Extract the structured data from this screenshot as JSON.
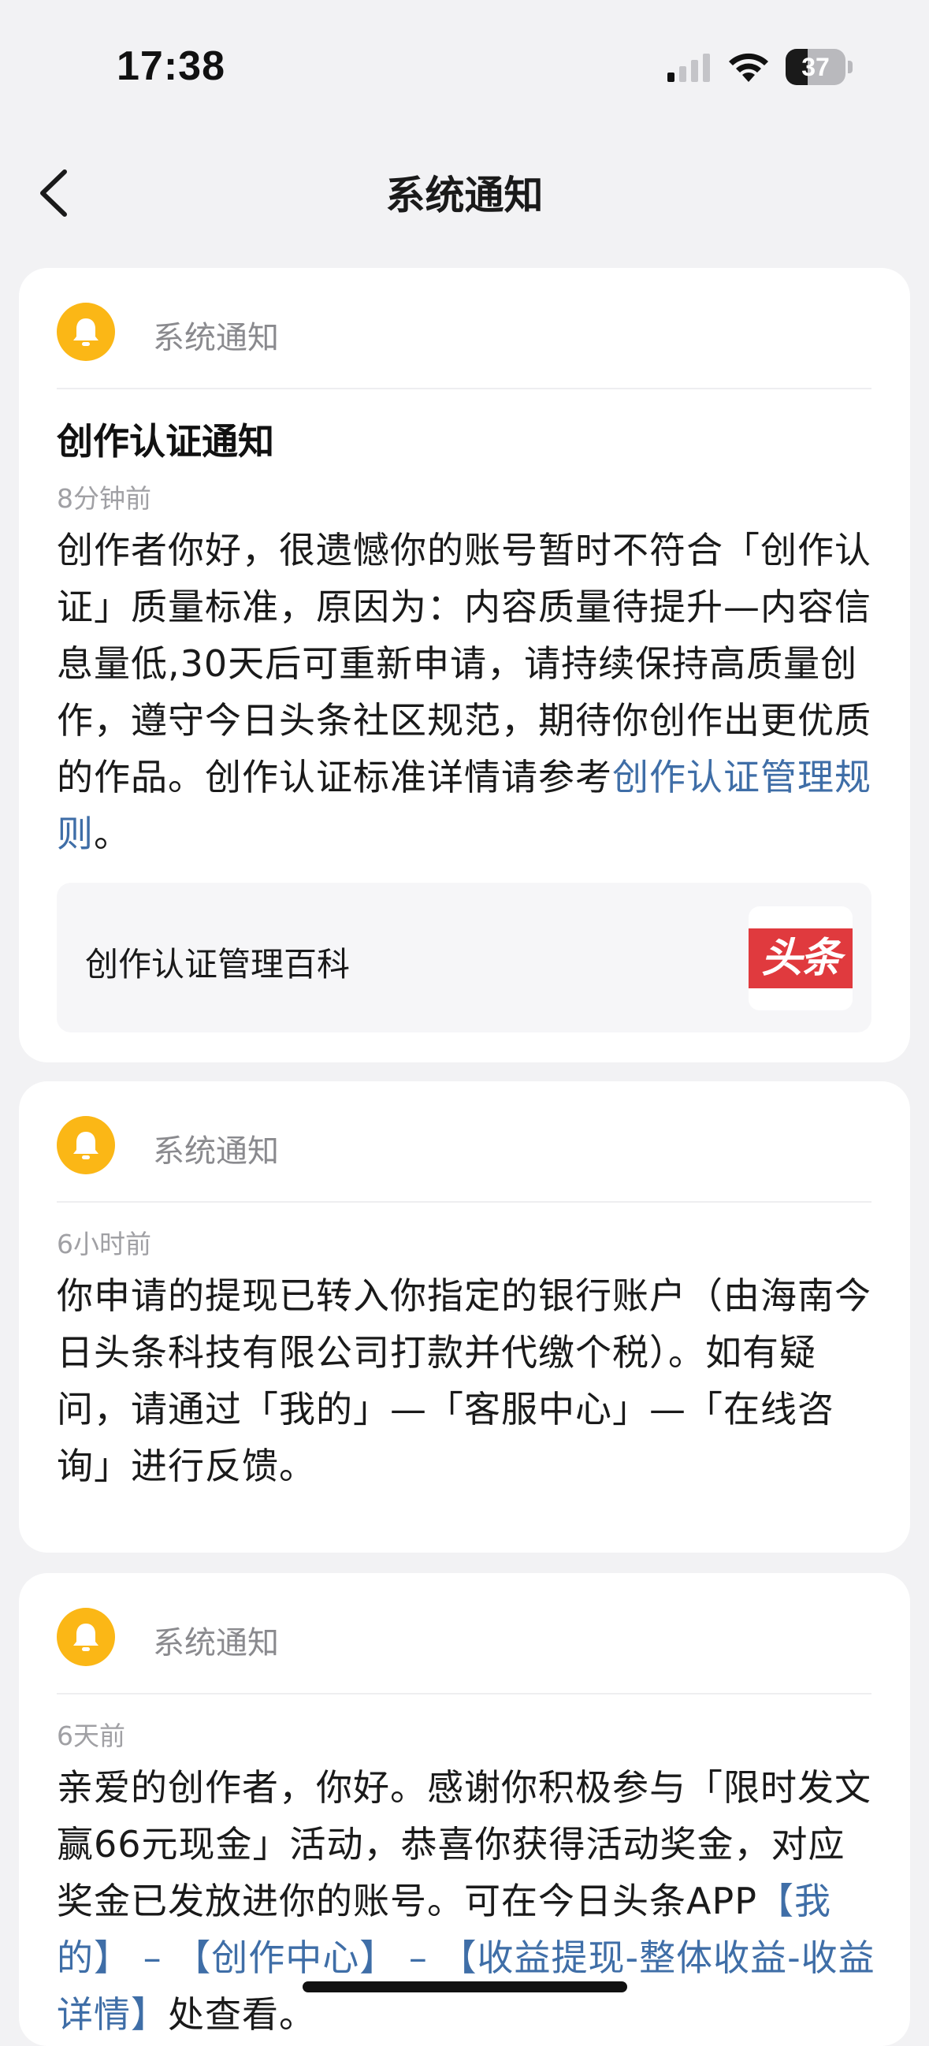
{
  "status_bar": {
    "time": "17:38",
    "battery": "37",
    "battery_level": 0.37
  },
  "nav": {
    "title": "系统通知"
  },
  "notifications": [
    {
      "sender": "系统通知",
      "title": "创作认证通知",
      "time": "8分钟前",
      "body_text": "创作者你好，很遗憾你的账号暂时不符合「创作认证」质量标准，原因为：内容质量待提升—内容信息量低,30天后可重新申请，请持续保持高质量创作，遵守今日头条社区规范，期待你创作出更优质的作品。创作认证标准详情请参考",
      "body_link": "创作认证管理规则",
      "body_end": "。",
      "link_card_label": "创作认证管理百科",
      "link_card_logo": "头条"
    },
    {
      "sender": "系统通知",
      "time": "6小时前",
      "body_text": "你申请的提现已转入你指定的银行账户（由海南今日头条科技有限公司打款并代缴个税）。如有疑问，请通过「我的」—「客服中心」—「在线咨询」进行反馈。"
    },
    {
      "sender": "系统通知",
      "time": "6天前",
      "body_text": "亲爱的创作者，你好。感谢你积极参与「限时发文 赢66元现金」活动，恭喜你获得活动奖金，对应奖金已发放进你的账号。可在今日头条APP",
      "body_link": "【我的】 – 【创作中心】 – 【收益提现-整体收益-收益详情】",
      "body_end": "处查看。"
    }
  ],
  "colors": {
    "accent_link": "#3f6ea7",
    "bell_badge": "#fbb716",
    "logo_red": "#e03a3e"
  }
}
